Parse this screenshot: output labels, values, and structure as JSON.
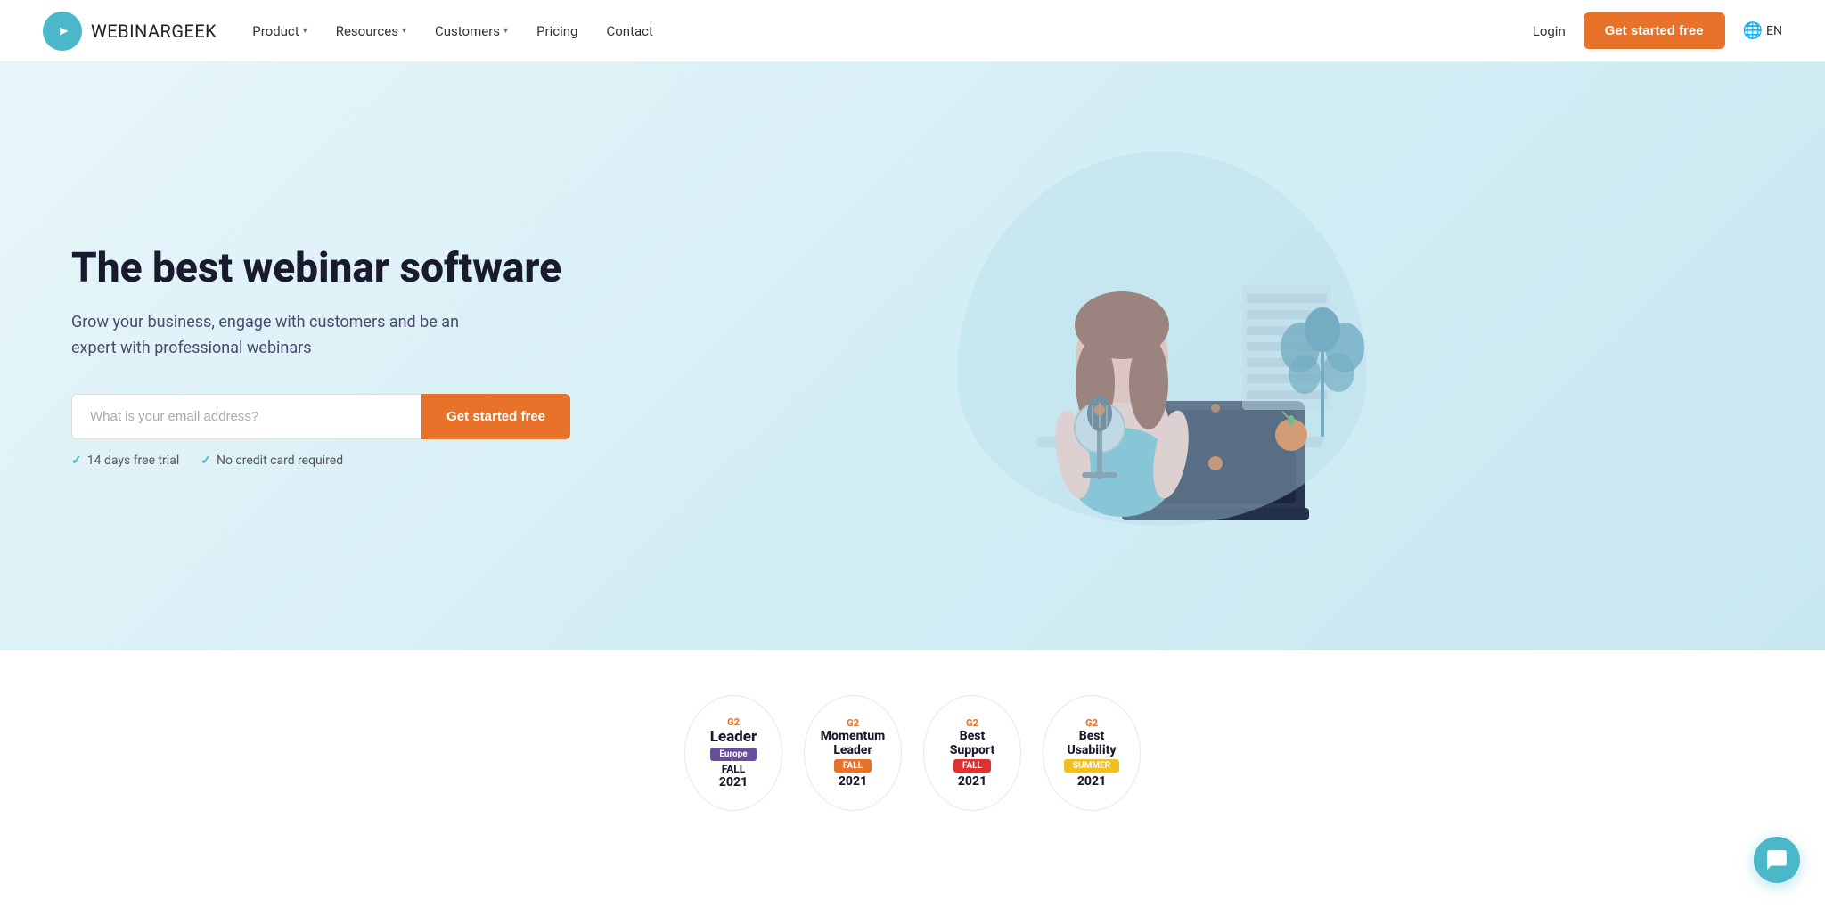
{
  "brand": {
    "name_bold": "WEBINAR",
    "name_regular": "GEEK"
  },
  "navbar": {
    "links": [
      {
        "label": "Product",
        "has_dropdown": true
      },
      {
        "label": "Resources",
        "has_dropdown": true
      },
      {
        "label": "Customers",
        "has_dropdown": true
      },
      {
        "label": "Pricing",
        "has_dropdown": false
      },
      {
        "label": "Contact",
        "has_dropdown": false
      }
    ],
    "login_label": "Login",
    "cta_label": "Get started free",
    "lang_label": "EN"
  },
  "hero": {
    "title": "The best webinar software",
    "subtitle": "Grow your business, engage with customers and be an expert with professional webinars",
    "input_placeholder": "What is your email address?",
    "cta_label": "Get started free",
    "check1": "14 days free trial",
    "check2": "No credit card required"
  },
  "badges": [
    {
      "g2_label": "G2",
      "main_label": "Leader",
      "sub_label": "Europe",
      "sub_color": "purple",
      "year_label": "FALL",
      "year_num": "2021"
    },
    {
      "g2_label": "G2",
      "main_label": "Momentum",
      "main_label2": "Leader",
      "sub_label": "FALL",
      "sub_color": "orange",
      "year_label": "",
      "year_num": "2021"
    },
    {
      "g2_label": "G2",
      "main_label": "Best",
      "main_label2": "Support",
      "sub_label": "FALL",
      "sub_color": "red",
      "year_label": "",
      "year_num": "2021"
    },
    {
      "g2_label": "G2",
      "main_label": "Best",
      "main_label2": "Usability",
      "sub_label": "SUMMER",
      "sub_color": "yellow",
      "year_label": "",
      "year_num": "2021"
    }
  ],
  "chat": {
    "icon": "chat-icon"
  }
}
